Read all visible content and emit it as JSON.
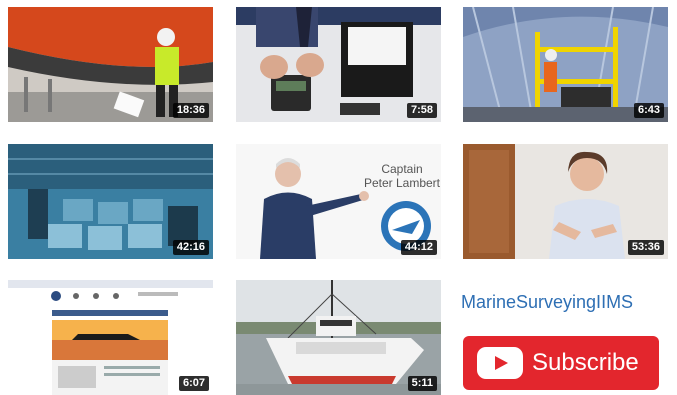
{
  "videos": [
    {
      "duration": "18:36"
    },
    {
      "duration": "7:58"
    },
    {
      "duration": "6:43"
    },
    {
      "duration": "42:16"
    },
    {
      "duration": "44:12",
      "overlay_name": "Captain",
      "overlay_name2": "Peter Lambert"
    },
    {
      "duration": "53:36"
    },
    {
      "duration": "6:07"
    },
    {
      "duration": "5:11"
    }
  ],
  "channel": {
    "name": "MarineSurveyingIIMS"
  },
  "subscribe": {
    "label": "Subscribe",
    "color": "#e3262d"
  },
  "colors": {
    "link": "#2e6fb4",
    "brand_red": "#e3262d"
  }
}
